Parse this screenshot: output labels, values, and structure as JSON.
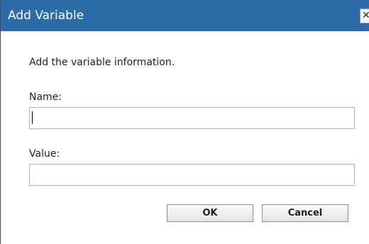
{
  "dialog": {
    "title": "Add Variable",
    "close_icon": "close-icon",
    "close_glyph": "✕",
    "instructions": "Add the variable information.",
    "name_label": "Name:",
    "name_value": "",
    "value_label": "Value:",
    "value_value": "",
    "ok_label": "OK",
    "cancel_label": "Cancel"
  },
  "colors": {
    "titlebar": "#2b6ba8",
    "title_text": "#ffffff",
    "field_border": "#b4b4b4"
  }
}
